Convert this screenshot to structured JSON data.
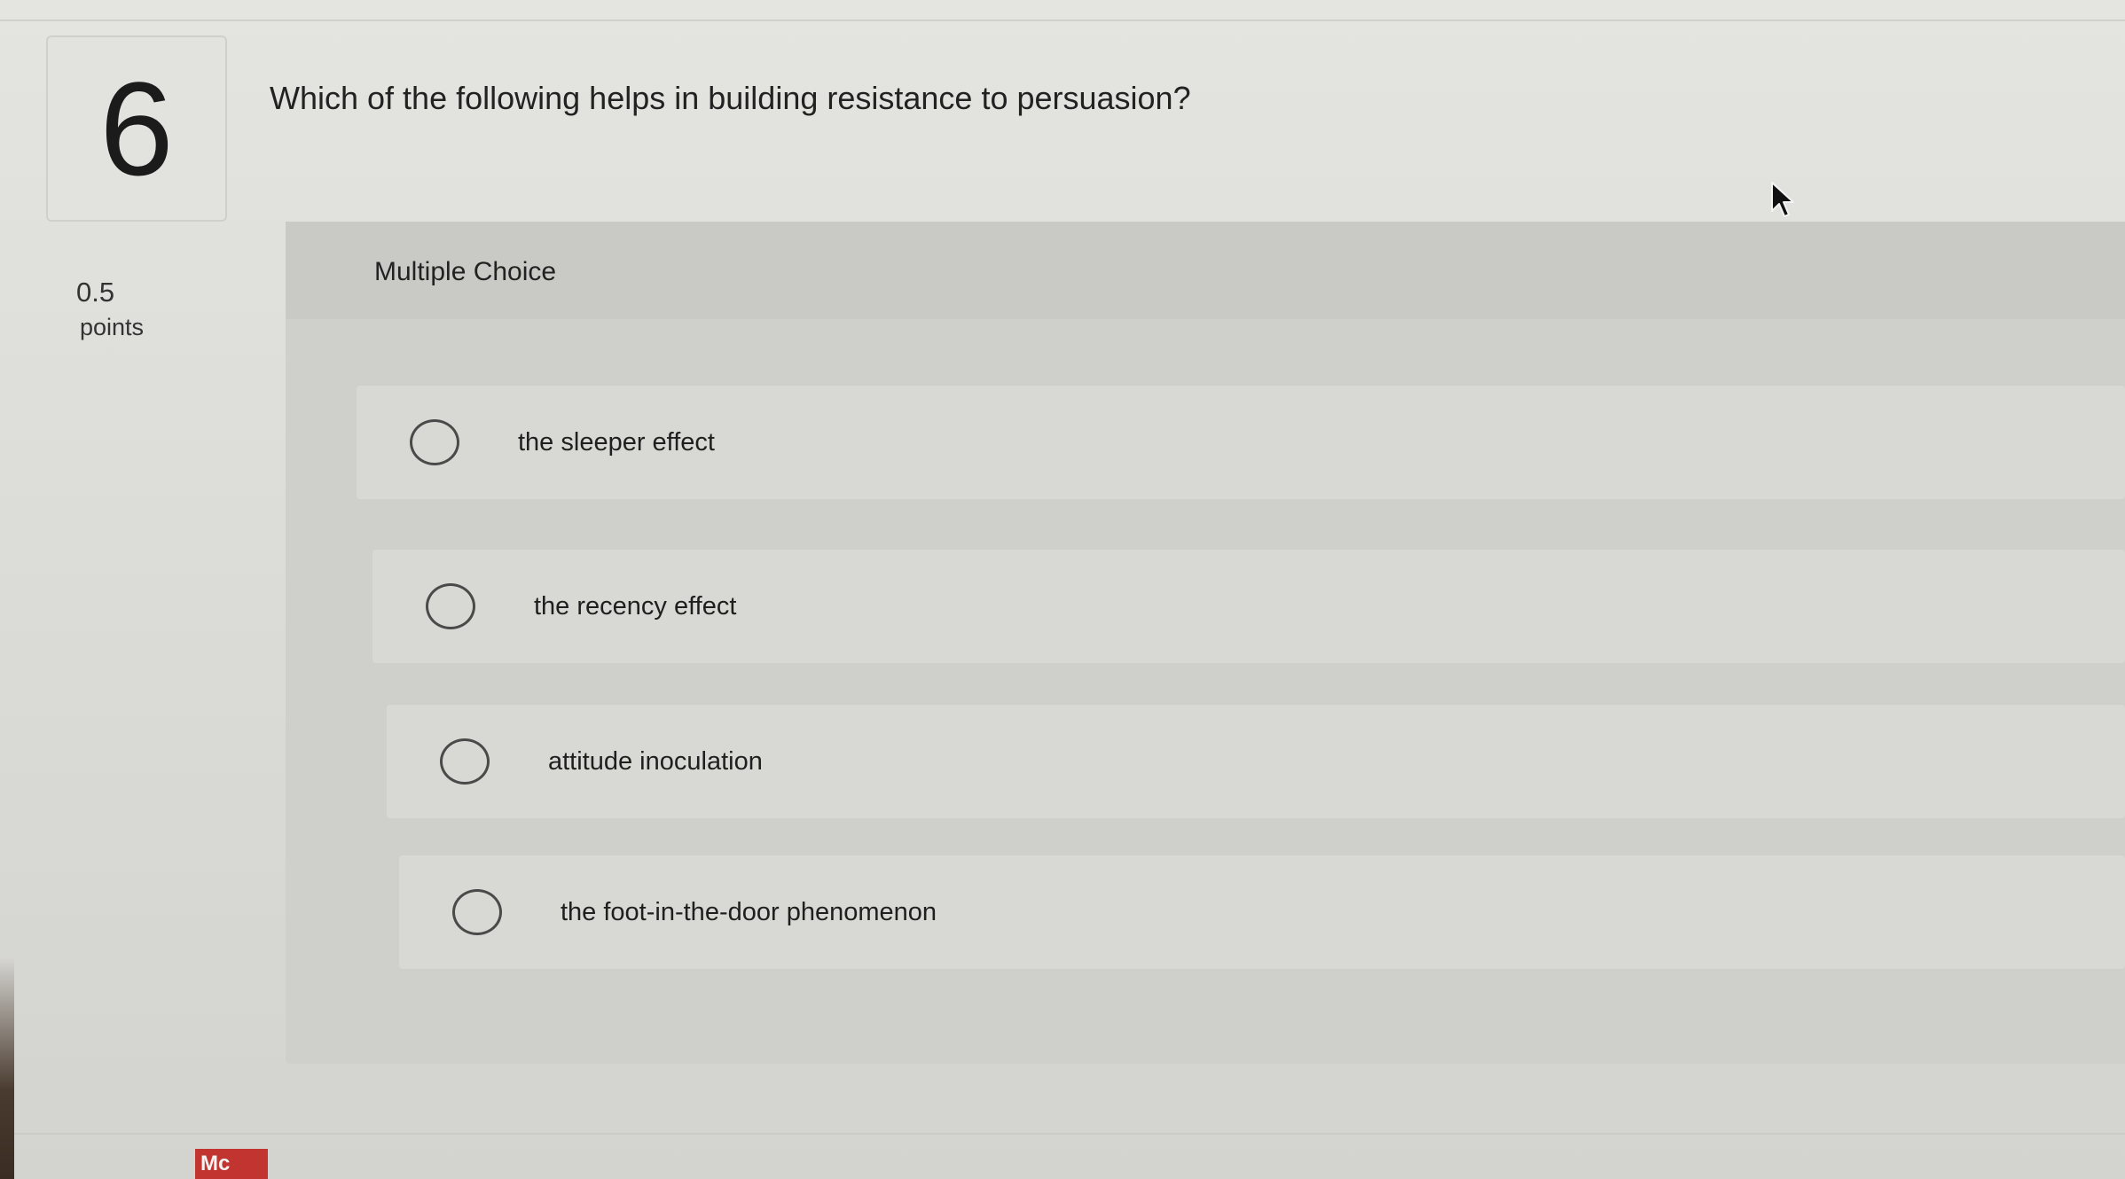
{
  "question": {
    "number": "6",
    "text": "Which of the following helps in building resistance to persuasion?",
    "points_value": "0.5",
    "points_label": "points"
  },
  "answer_area": {
    "type_label": "Multiple Choice",
    "options": [
      {
        "label": "the sleeper effect",
        "selected": false
      },
      {
        "label": "the recency effect",
        "selected": false
      },
      {
        "label": "attitude inoculation",
        "selected": false
      },
      {
        "label": "the foot-in-the-door phenomenon",
        "selected": false
      }
    ]
  },
  "footer": {
    "logo_text": "Mc"
  },
  "icons": {
    "cursor": "mouse-pointer-icon",
    "radio": "radio-circle-icon"
  },
  "colors": {
    "logo_red": "#c1342f",
    "radio_border": "#4a4a4a"
  }
}
